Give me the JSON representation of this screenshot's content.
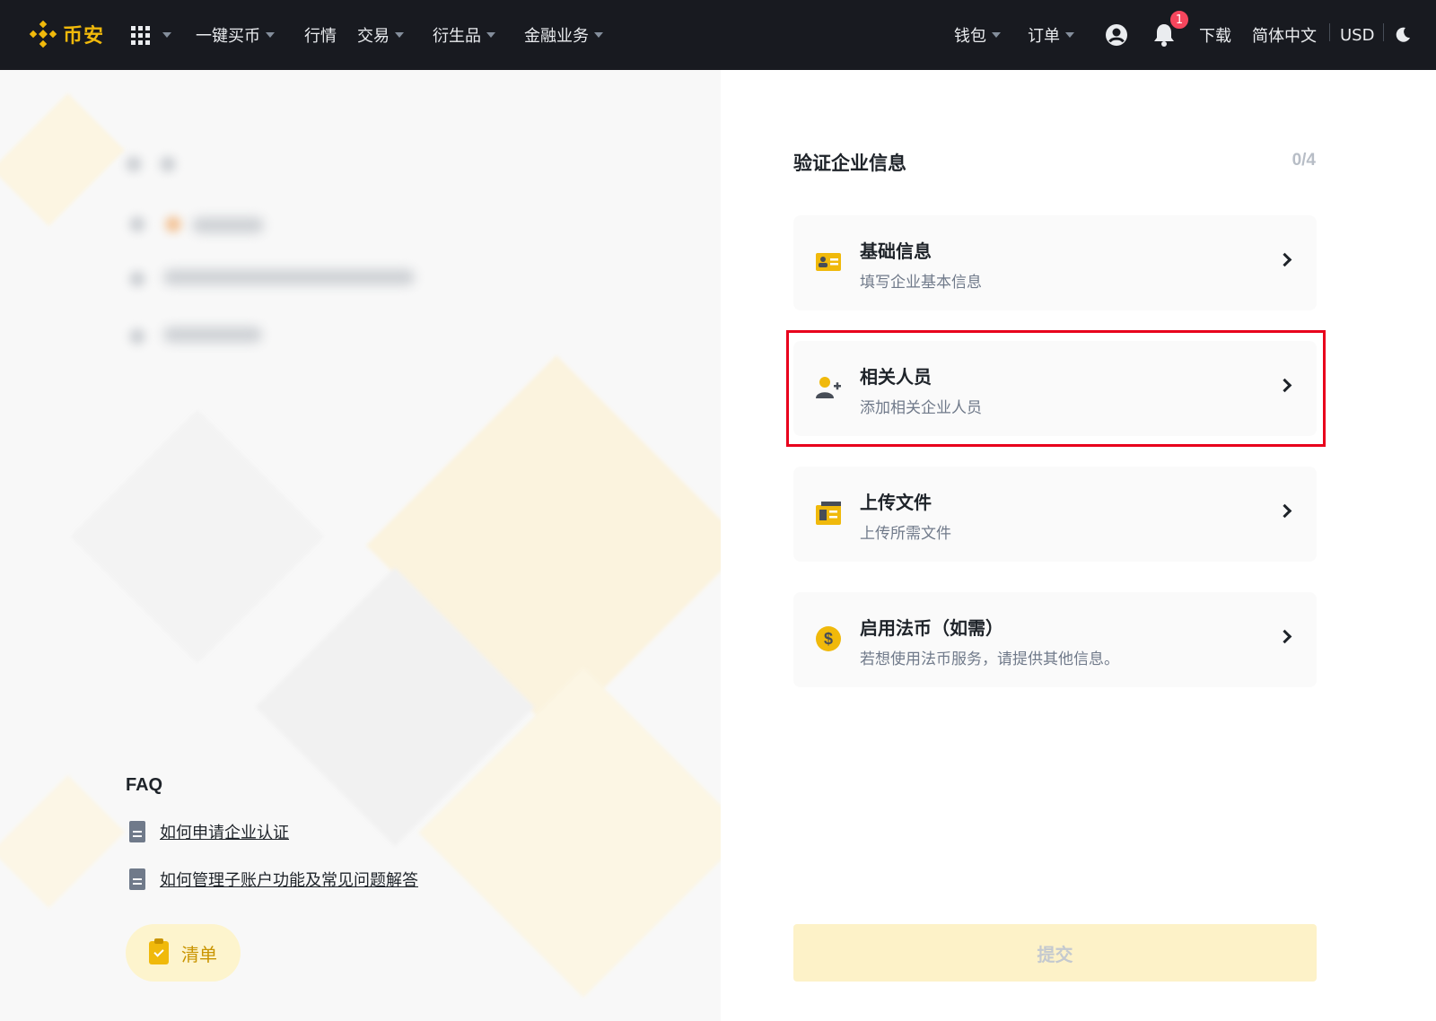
{
  "nav": {
    "brand": "币安",
    "items": [
      {
        "label": "一键买币",
        "dropdown": true
      },
      {
        "label": "行情",
        "dropdown": false
      },
      {
        "label": "交易",
        "dropdown": true
      },
      {
        "label": "衍生品",
        "dropdown": true
      },
      {
        "label": "金融业务",
        "dropdown": true
      }
    ],
    "right": {
      "wallet": "钱包",
      "orders": "订单",
      "notifications_count": "1",
      "download": "下载",
      "language": "简体中文",
      "currency": "USD"
    }
  },
  "faq": {
    "title": "FAQ",
    "links": [
      "如何申请企业认证",
      "如何管理子账户功能及常见问题解答"
    ]
  },
  "checklist_label": "清单",
  "verify": {
    "title": "验证企业信息",
    "progress": "0/4",
    "cards": [
      {
        "title": "基础信息",
        "subtitle": "填写企业基本信息",
        "icon": "id-card-icon"
      },
      {
        "title": "相关人员",
        "subtitle": "添加相关企业人员",
        "icon": "add-person-icon"
      },
      {
        "title": "上传文件",
        "subtitle": "上传所需文件",
        "icon": "document-upload-icon"
      },
      {
        "title": "启用法币（如需）",
        "subtitle": "若想使用法币服务，请提供其他信息。",
        "icon": "dollar-coin-icon"
      }
    ],
    "highlighted_card": "相关人员",
    "submit_label": "提交"
  },
  "colors": {
    "brand": "#f0b90b",
    "nav_bg": "#181a20",
    "highlight_border": "#e8001c",
    "badge": "#f6465d"
  }
}
